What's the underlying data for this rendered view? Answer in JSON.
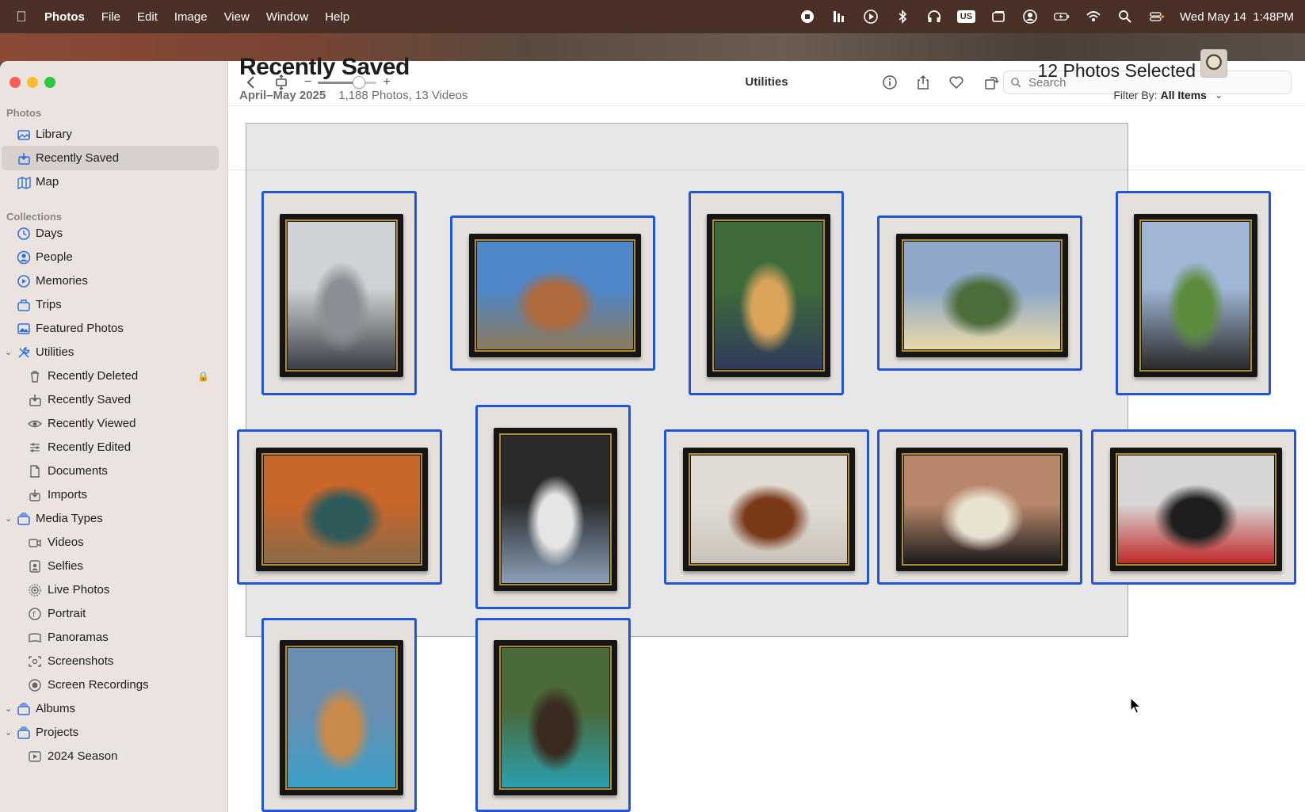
{
  "menubar": {
    "app": "Photos",
    "items": [
      "File",
      "Edit",
      "Image",
      "View",
      "Window",
      "Help"
    ],
    "keyboard_badge": "US",
    "datetime": "Wed May 14  1:48PM"
  },
  "sidebar": {
    "sections": {
      "photos": "Photos",
      "collections": "Collections"
    },
    "items": [
      {
        "label": "Library",
        "icon": "photo-library-icon"
      },
      {
        "label": "Recently Saved",
        "icon": "recently-saved-icon",
        "selected": true
      },
      {
        "label": "Map",
        "icon": "map-icon"
      },
      {
        "label": "Days",
        "icon": "clock-icon"
      },
      {
        "label": "People",
        "icon": "person-circle-icon"
      },
      {
        "label": "Memories",
        "icon": "memories-icon"
      },
      {
        "label": "Trips",
        "icon": "suitcase-icon"
      },
      {
        "label": "Featured Photos",
        "icon": "featured-photos-icon"
      },
      {
        "label": "Utilities",
        "icon": "wrench-screwdriver-icon"
      },
      {
        "label": "Recently Deleted",
        "icon": "trash-icon"
      },
      {
        "label": "Recently Saved",
        "icon": "recently-saved-icon"
      },
      {
        "label": "Recently Viewed",
        "icon": "eye-icon"
      },
      {
        "label": "Recently Edited",
        "icon": "sliders-icon"
      },
      {
        "label": "Documents",
        "icon": "document-icon"
      },
      {
        "label": "Imports",
        "icon": "import-icon"
      },
      {
        "label": "Media Types",
        "icon": "stack-icon"
      },
      {
        "label": "Videos",
        "icon": "video-icon"
      },
      {
        "label": "Selfies",
        "icon": "selfie-icon"
      },
      {
        "label": "Live Photos",
        "icon": "live-photo-icon"
      },
      {
        "label": "Portrait",
        "icon": "portrait-icon"
      },
      {
        "label": "Panoramas",
        "icon": "panorama-icon"
      },
      {
        "label": "Screenshots",
        "icon": "screenshot-icon"
      },
      {
        "label": "Screen Recordings",
        "icon": "screen-recording-icon"
      },
      {
        "label": "Albums",
        "icon": "album-stack-icon"
      },
      {
        "label": "Projects",
        "icon": "project-stack-icon"
      },
      {
        "label": "2024 Season",
        "icon": "project-icon"
      }
    ]
  },
  "toolbar": {
    "title": "Utilities",
    "zoom_level": 0.7,
    "search_placeholder": "Search"
  },
  "header": {
    "title": "Recently Saved",
    "date_range": "April–May 2025",
    "counts": "1,188 Photos, 13 Videos",
    "selected_label": "12 Photos Selected",
    "filter_label": "Filter By:",
    "filter_value": "All Items"
  },
  "photos": [
    {
      "subject": "white labrador portrait",
      "colors": [
        "#cfd2d6",
        "#8a8f95",
        "#3a3f46"
      ],
      "selected": true
    },
    {
      "subject": "dachshund outdoors",
      "colors": [
        "#4f87c9",
        "#b06a3c",
        "#8c7a5a"
      ],
      "selected": true
    },
    {
      "subject": "golden retriever with bandana",
      "colors": [
        "#3f6b3a",
        "#d9a35a",
        "#2f3a5c"
      ],
      "selected": true
    },
    {
      "subject": "dog in field at sunset",
      "colors": [
        "#8fa8c9",
        "#4d6d3a",
        "#e8d8a8"
      ],
      "selected": true
    },
    {
      "subject": "black and white dog on lawn",
      "colors": [
        "#9fb6d4",
        "#5e8c3e",
        "#2a2a2a"
      ],
      "selected": true
    },
    {
      "subject": "labrador by truck with pumpkins",
      "colors": [
        "#c9662a",
        "#2f5a5a",
        "#8a6a4a"
      ],
      "selected": true
    },
    {
      "subject": "phone screenshot of dog",
      "colors": [
        "#2a2a2a",
        "#e5e5e5",
        "#8aa0b8"
      ],
      "selected": true
    },
    {
      "subject": "hound lying on floor",
      "colors": [
        "#e0dbd4",
        "#7a3a1a",
        "#c9c2b8"
      ],
      "selected": true
    },
    {
      "subject": "lab and black puppy",
      "colors": [
        "#b8876a",
        "#e8e2d0",
        "#1e1e1e"
      ],
      "selected": true
    },
    {
      "subject": "dog with santa hat",
      "colors": [
        "#d8d6d4",
        "#1e1e1e",
        "#c02a2a"
      ],
      "selected": true
    },
    {
      "subject": "golden puppy in blue",
      "colors": [
        "#6a8eb0",
        "#c98a4a",
        "#3aa0c8"
      ],
      "selected": true
    },
    {
      "subject": "chocolate lab on wicker chair",
      "colors": [
        "#4a6a3a",
        "#3a2a20",
        "#2aa0b0"
      ],
      "selected": true
    }
  ]
}
